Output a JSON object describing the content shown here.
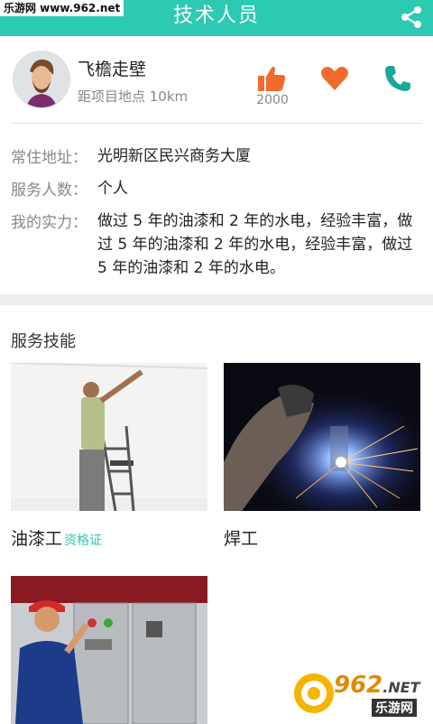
{
  "watermark_top": "乐游网 www.962.net",
  "header": {
    "title": "技术人员",
    "share_icon": "share-icon"
  },
  "profile": {
    "name": "飞檐走壁",
    "distance": "距项目地点 10km",
    "like_count": "2000",
    "icons": [
      "thumbs-up-icon",
      "heart-icon",
      "phone-icon"
    ]
  },
  "info": {
    "address_label": "常住地址：",
    "address_value": "光明新区民兴商务大厦",
    "count_label": "服务人数：",
    "count_value": "个人",
    "ability_label": "我的实力：",
    "ability_value": "做过 5 年的油漆和 2 年的水电，经验丰富，做过 5 年的油漆和 2 年的水电，经验丰富，做过 5 年的油漆和 2 年的水电。"
  },
  "skills": {
    "title": "服务技能",
    "items": [
      {
        "name": "油漆工",
        "badge": "资格证"
      },
      {
        "name": "焊工"
      },
      {
        "name": ""
      }
    ]
  },
  "watermark_bottom": {
    "number": "962",
    "net": ".NET",
    "brand": "乐游网"
  },
  "colors": {
    "accent": "#2cc9b3",
    "action_orange": "#f26a2c",
    "phone_teal": "#1aa89a"
  }
}
